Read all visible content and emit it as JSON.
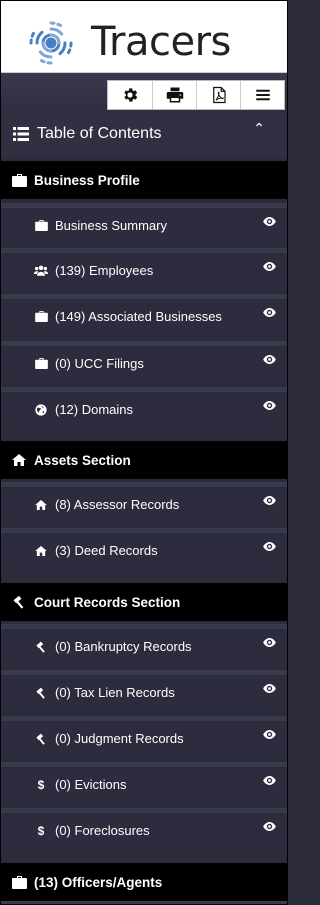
{
  "brand": {
    "name": "Tracers"
  },
  "toolbar": {
    "buttons": [
      {
        "icon": "gear-icon"
      },
      {
        "icon": "print-icon"
      },
      {
        "icon": "pdf-icon"
      },
      {
        "icon": "menu-icon"
      }
    ]
  },
  "toc": {
    "title": "Table of Contents",
    "collapse_icon": "chevron-up-icon"
  },
  "sections": {
    "business": {
      "title": "Business Profile",
      "items": [
        {
          "label": "Business Summary",
          "icon": "briefcase-icon"
        },
        {
          "label": "(139) Employees",
          "icon": "users-icon"
        },
        {
          "label": "(149) Associated Businesses",
          "icon": "briefcase-icon"
        },
        {
          "label": "(0) UCC Filings",
          "icon": "briefcase-icon"
        },
        {
          "label": "(12) Domains",
          "icon": "globe-icon"
        }
      ]
    },
    "assets": {
      "title": "Assets Section",
      "items": [
        {
          "label": "(8) Assessor Records",
          "icon": "home-icon"
        },
        {
          "label": "(3) Deed Records",
          "icon": "home-icon"
        }
      ]
    },
    "court": {
      "title": "Court Records Section",
      "items": [
        {
          "label": "(0) Bankruptcy Records",
          "icon": "gavel-icon"
        },
        {
          "label": "(0) Tax Lien Records",
          "icon": "gavel-icon"
        },
        {
          "label": "(0) Judgment Records",
          "icon": "gavel-icon"
        },
        {
          "label": "(0) Evictions",
          "icon": "dollar-icon",
          "glyph": "$"
        },
        {
          "label": "(0) Foreclosures",
          "icon": "dollar-icon",
          "glyph": "$"
        }
      ]
    },
    "officers": {
      "title": "(13) Officers/Agents"
    }
  },
  "colors": {
    "accent": "#3b6fb5",
    "background": "#2c2c3e",
    "section_bg": "#000000",
    "divider": "#3a3a4d"
  }
}
